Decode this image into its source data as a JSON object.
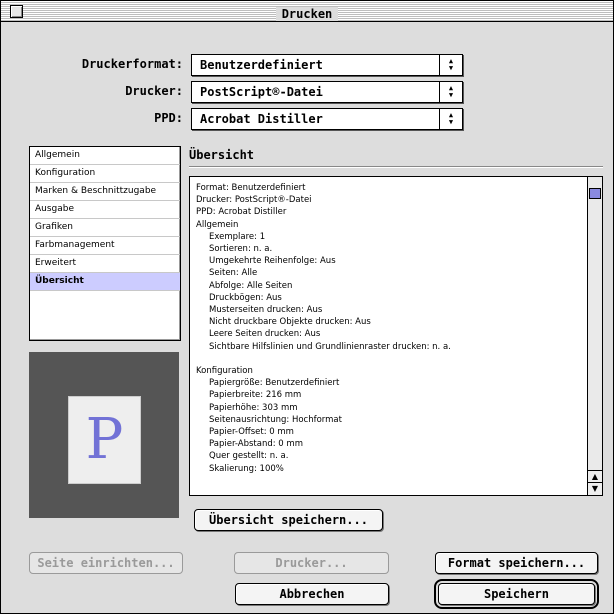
{
  "window": {
    "title": "Drucken"
  },
  "form": {
    "druckerformat": {
      "label": "Druckerformat:",
      "value": "Benutzerdefiniert"
    },
    "drucker": {
      "label": "Drucker:",
      "value": "PostScript®-Datei"
    },
    "ppd": {
      "label": "PPD:",
      "value": "Acrobat Distiller"
    }
  },
  "sidebar": {
    "items": [
      {
        "label": "Allgemein"
      },
      {
        "label": "Konfiguration"
      },
      {
        "label": "Marken & Beschnittzugabe"
      },
      {
        "label": "Ausgabe"
      },
      {
        "label": "Grafiken"
      },
      {
        "label": "Farbmanagement"
      },
      {
        "label": "Erweitert"
      },
      {
        "label": "Übersicht"
      }
    ],
    "selected": "Übersicht"
  },
  "preview": {
    "glyph": "P"
  },
  "section": {
    "title": "Übersicht"
  },
  "summary": {
    "lines": [
      "Format: Benutzerdefiniert",
      "Drucker: PostScript®-Datei",
      "PPD: Acrobat Distiller",
      "Allgemein",
      "Exemplare: 1",
      "Sortieren: n. a.",
      "Umgekehrte Reihenfolge: Aus",
      "Seiten: Alle",
      "Abfolge: Alle Seiten",
      "Druckbögen: Aus",
      "Musterseiten drucken: Aus",
      "Nicht druckbare Objekte drucken: Aus",
      "Leere Seiten drucken: Aus",
      "Sichtbare Hilfslinien und Grundlinienraster drucken: n. a.",
      "Konfiguration",
      "Papiergröße: Benutzerdefiniert",
      "Papierbreite: 216 mm",
      "Papierhöhe: 303 mm",
      "Seitenausrichtung: Hochformat",
      "Papier-Offset: 0 mm",
      "Papier-Abstand: 0 mm",
      "Quer gestellt: n. a.",
      "Skalierung: 100%"
    ]
  },
  "buttons": {
    "save_summary": "Übersicht speichern...",
    "page_setup": "Seite einrichten...",
    "printer": "Drucker...",
    "save_format": "Format speichern...",
    "cancel": "Abbrechen",
    "save": "Speichern"
  },
  "colors": {
    "selection": "#ccccff",
    "scroll_thumb": "#8a8ae0",
    "preview_bg": "#555555",
    "glyph": "#7272d6"
  }
}
